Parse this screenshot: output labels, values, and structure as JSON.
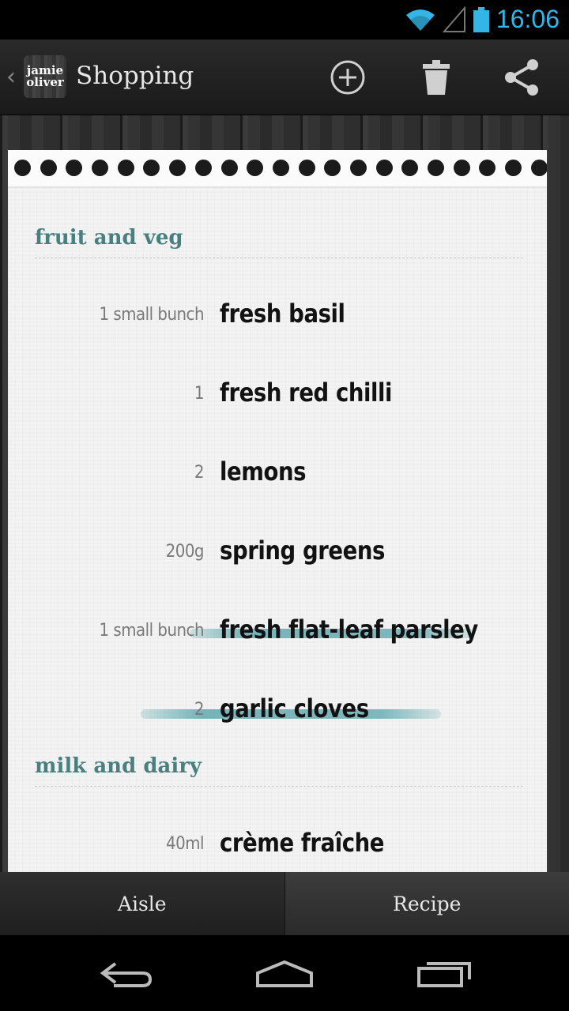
{
  "status_bar": {
    "time": "16:06",
    "icons": [
      "wifi-icon",
      "signal-icon",
      "battery-icon"
    ],
    "accent_color": "#33b5e5"
  },
  "action_bar": {
    "logo_line1": "jamie",
    "logo_line2": "oliver",
    "title": "Shopping",
    "actions": [
      "add-icon",
      "trash-icon",
      "share-icon"
    ]
  },
  "list": {
    "section_color": "#4a7f80",
    "sections": [
      {
        "title": "fruit and veg",
        "items": [
          {
            "qty": "1 small bunch",
            "name": "fresh basil",
            "checked": false
          },
          {
            "qty": "1",
            "name": "fresh red chilli",
            "checked": false
          },
          {
            "qty": "2",
            "name": "lemons",
            "checked": false
          },
          {
            "qty": "200g",
            "name": "spring greens",
            "checked": false
          },
          {
            "qty": "1 small bunch",
            "name": "fresh flat-leaf parsley",
            "checked": true
          },
          {
            "qty": "2",
            "name": "garlic cloves",
            "checked": true
          }
        ]
      },
      {
        "title": "milk and dairy",
        "items": [
          {
            "qty": "40ml",
            "name": "crème fraîche",
            "checked": false
          }
        ]
      }
    ]
  },
  "tabs": {
    "aisle": "Aisle",
    "recipe": "Recipe"
  },
  "nav_bar": {
    "buttons": [
      "back-icon",
      "home-icon",
      "recents-icon"
    ]
  }
}
